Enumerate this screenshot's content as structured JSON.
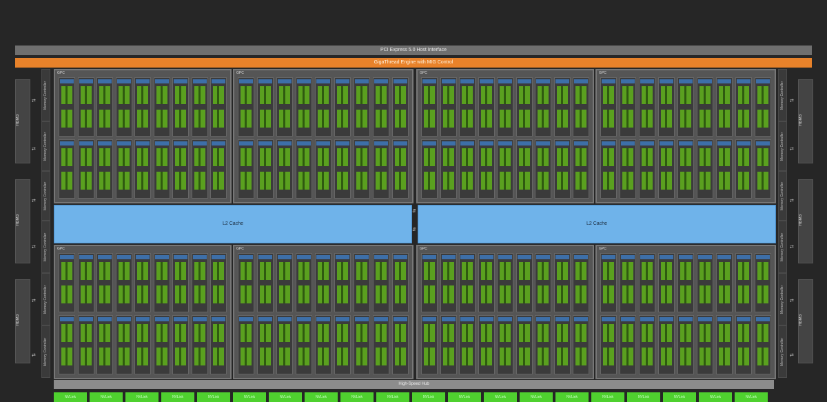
{
  "header": {
    "pcie_label": "PCI Express 5.0 Host Interface",
    "giga_label": "GigaThread Engine with MIG Control"
  },
  "hbm": {
    "label": "HBM3"
  },
  "memory_controller": {
    "label": "Memory Controller"
  },
  "gpc": {
    "label": "GPC"
  },
  "l2": {
    "label": "L2 Cache"
  },
  "hub": {
    "label": "High-Speed Hub"
  },
  "nvlink": {
    "label": "NVLink"
  },
  "colors": {
    "background": "#262626",
    "pcie_bar": "#6f6f6f",
    "gigathread_bar": "#e8822a",
    "l2_cache": "#6fb3ea",
    "sm": "#5aa01f",
    "nvlink": "#4fd12f"
  }
}
